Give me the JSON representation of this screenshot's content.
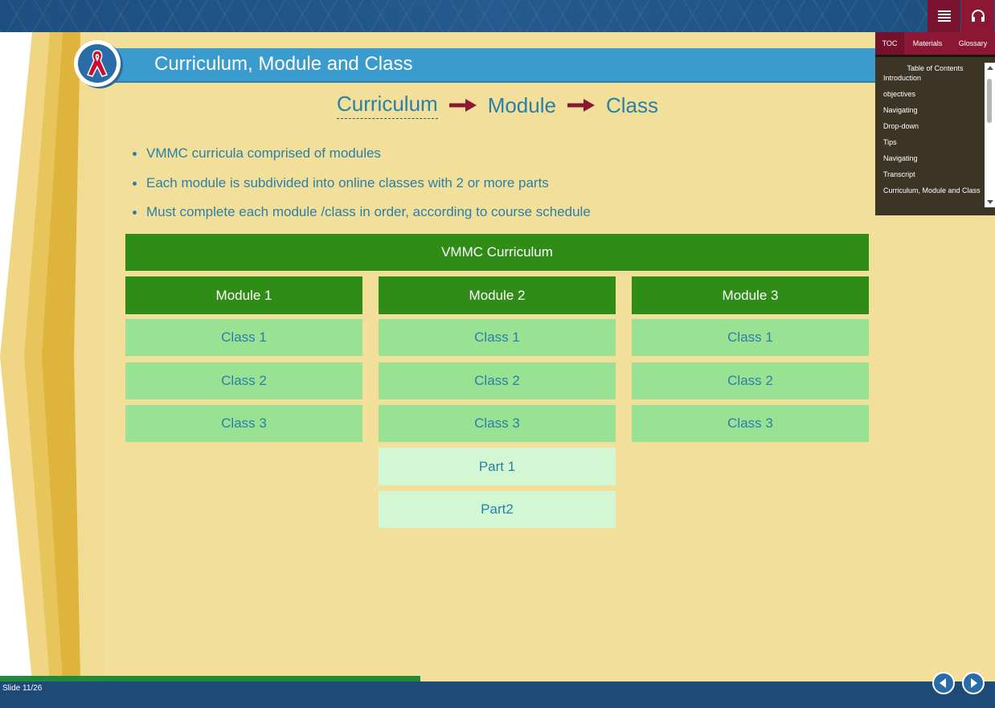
{
  "header": {
    "menu_icon": "hamburger-menu-icon",
    "audio_icon": "headphones-icon"
  },
  "slide": {
    "title": "Curriculum, Module and Class",
    "flow": {
      "step1": "Curriculum",
      "step2": "Module",
      "step3": "Class"
    },
    "bullets": [
      "VMMC curricula comprised of modules",
      "Each module is subdivided into online classes with 2 or more parts",
      "Must complete each module /class in order, according to course schedule"
    ],
    "diagram": {
      "root": "VMMC Curriculum",
      "modules": [
        {
          "label": "Module 1",
          "classes": [
            "Class 1",
            "Class 2",
            "Class 3"
          ]
        },
        {
          "label": "Module 2",
          "classes": [
            "Class 1",
            "Class 2",
            "Class 3"
          ],
          "parts": [
            "Part 1",
            "Part2"
          ]
        },
        {
          "label": "Module 3",
          "classes": [
            "Class 1",
            "Class 2",
            "Class 3"
          ]
        }
      ]
    }
  },
  "sidebar": {
    "tabs": [
      "TOC",
      "Materials",
      "Glossary"
    ],
    "active_tab": "TOC",
    "header": "Table of Contents",
    "items": [
      "Introduction",
      "objectives",
      "Navigating",
      "Drop-down",
      "Tips",
      "Navigating",
      "Transcript",
      "Curriculum, Module and Class"
    ]
  },
  "footer": {
    "slide_label": "Slide 11/26",
    "progress": 0.4225
  },
  "colors": {
    "accent_red": "#8b1735",
    "title_blue": "#3a9bcf",
    "dark_green": "#2e8c17",
    "mid_green": "#9ae293",
    "light_green": "#d3f7d3",
    "background": "#f2e09a"
  }
}
